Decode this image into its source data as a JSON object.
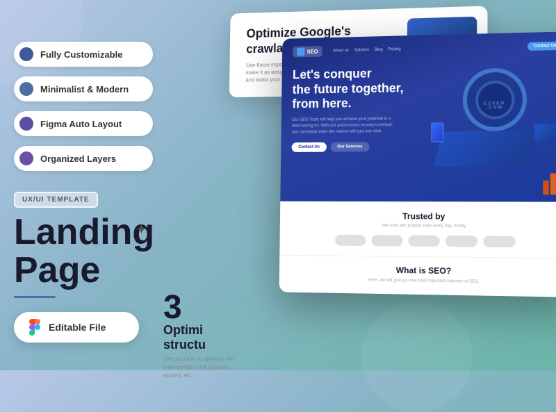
{
  "background": {
    "gradient_start": "#b8c8e8",
    "gradient_end": "#6ab5a8"
  },
  "features": {
    "items": [
      {
        "id": "customizable",
        "label": "Fully Customizable",
        "dot_color": "blue"
      },
      {
        "id": "minimalist",
        "label": "Minimalist & Modern",
        "dot_color": "indigo"
      },
      {
        "id": "figma",
        "label": "Figma Auto Layout",
        "dot_color": "violet"
      },
      {
        "id": "layers",
        "label": "Organized Layers",
        "dot_color": "purple"
      }
    ]
  },
  "template_badge": "UX/UI TEMPLATE",
  "main_title_line1": "Landing",
  "main_title_line2": "Page",
  "editable_file_label": "Editable File",
  "back_card": {
    "title": "Optimize Google's\ncrawlability.",
    "description": "Use these important topics to optimize the interface to make it as easy as possible for Google's crawlers to find and index your content in a more user-friendly manner."
  },
  "mockup": {
    "logo_text": "SEO",
    "nav_links": [
      "About us",
      "Solution",
      "Blog",
      "Pricing"
    ],
    "nav_cta": "Contact Us",
    "headline_line1": "Let's conquer",
    "headline_line2": "the future together,",
    "headline_line3": "from here.",
    "subtext": "Our SEO Tools will help you achieve your potential in a field looking for. With our autonomous research method, you can easily enter the market with just one click.",
    "btn_primary": "Contact Us",
    "btn_secondary": "Our Services",
    "ezseo_text": "EZSEO\n.COM"
  },
  "trusted": {
    "title": "Trusted by",
    "subtitle": "We work with popular tools every day, mostly"
  },
  "what_is": {
    "title": "What is SEO?",
    "text": "Here, we will give you the most important overview of SEO."
  },
  "number_section": {
    "number": "3",
    "label_line1": "Optimi",
    "label_line2": "structu",
    "desc": "Site structure to optimize the main content and organize, around, etc."
  }
}
